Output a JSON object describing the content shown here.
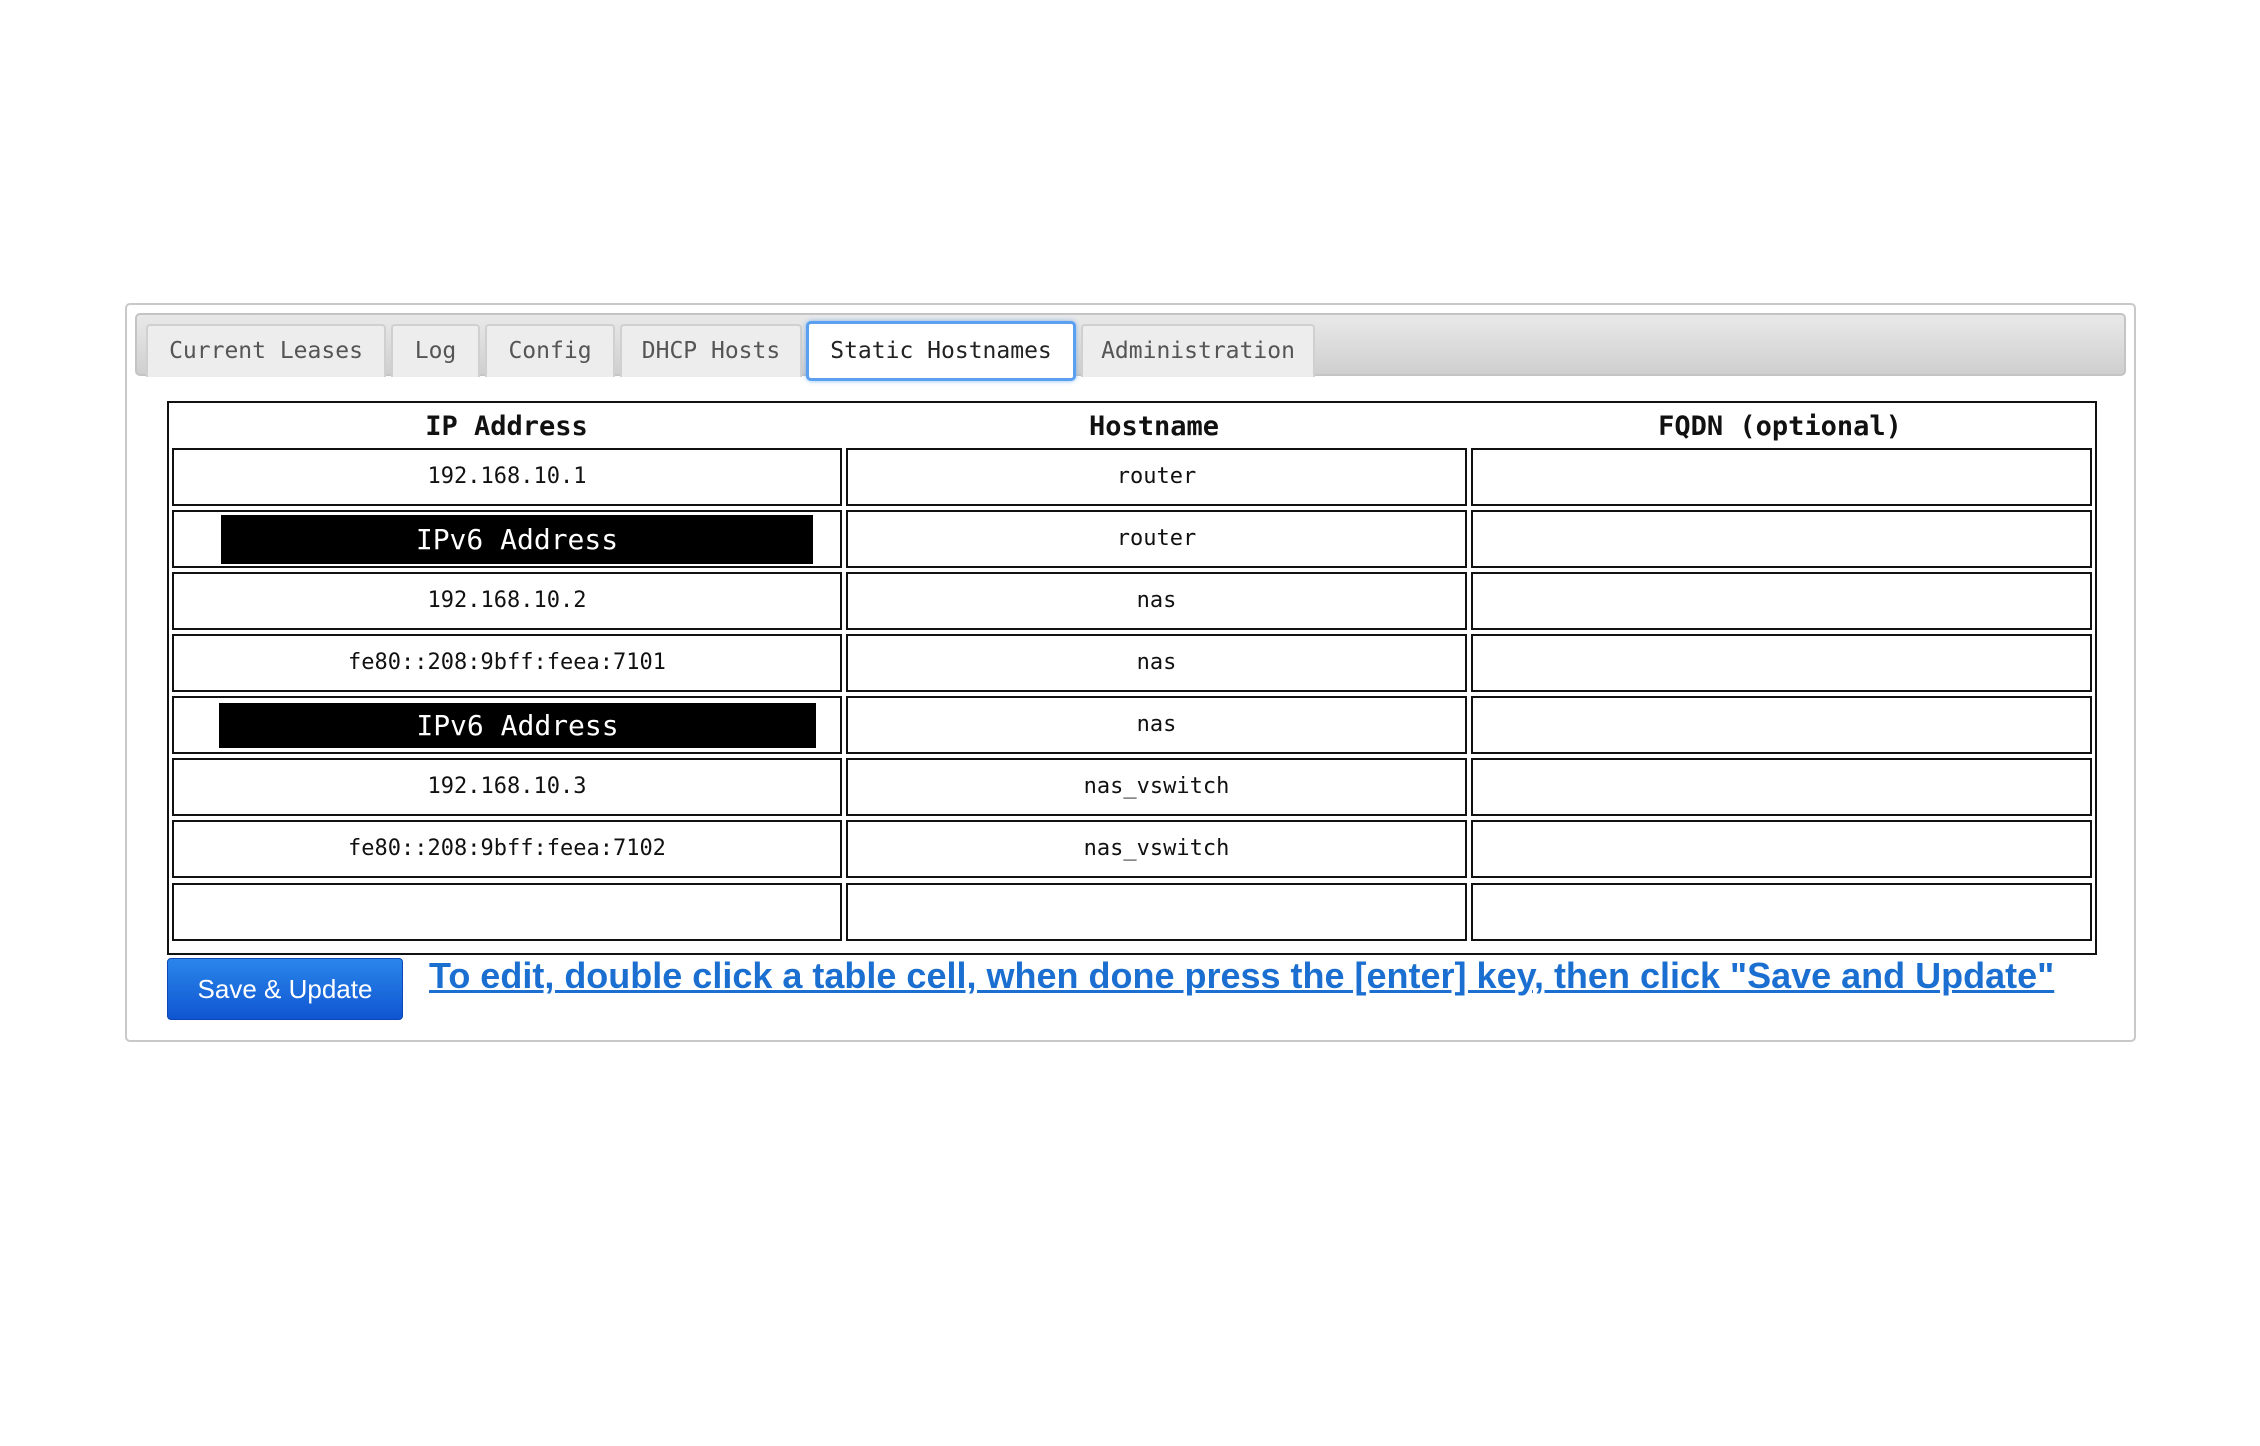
{
  "tabs": [
    {
      "label": "Current Leases",
      "active": false
    },
    {
      "label": "Log",
      "active": false
    },
    {
      "label": "Config",
      "active": false
    },
    {
      "label": "DHCP Hosts",
      "active": false
    },
    {
      "label": "Static Hostnames",
      "active": true
    },
    {
      "label": "Administration",
      "active": false
    }
  ],
  "table": {
    "headers": [
      "IP Address",
      "Hostname",
      "FQDN (optional)"
    ],
    "rows": [
      {
        "ip": "192.168.10.1",
        "hostname": "router",
        "fqdn": ""
      },
      {
        "ip": "IPv6 Address",
        "hostname": "router",
        "fqdn": "",
        "redacted": true
      },
      {
        "ip": "192.168.10.2",
        "hostname": "nas",
        "fqdn": ""
      },
      {
        "ip": "fe80::208:9bff:feea:7101",
        "hostname": "nas",
        "fqdn": ""
      },
      {
        "ip": "IPv6 Address",
        "hostname": "nas",
        "fqdn": "",
        "redacted": true
      },
      {
        "ip": "192.168.10.3",
        "hostname": "nas_vswitch",
        "fqdn": ""
      },
      {
        "ip": "fe80::208:9bff:feea:7102",
        "hostname": "nas_vswitch",
        "fqdn": ""
      },
      {
        "ip": "",
        "hostname": "",
        "fqdn": ""
      }
    ]
  },
  "actions": {
    "save_label": "Save & Update",
    "hint_text": "To edit, double click a table cell, when done press the [enter] key, then click \"Save and Update\""
  },
  "colors": {
    "accent": "#1a6fd0",
    "button": "#1565d8",
    "active_tab_border": "#5a9ff0"
  }
}
